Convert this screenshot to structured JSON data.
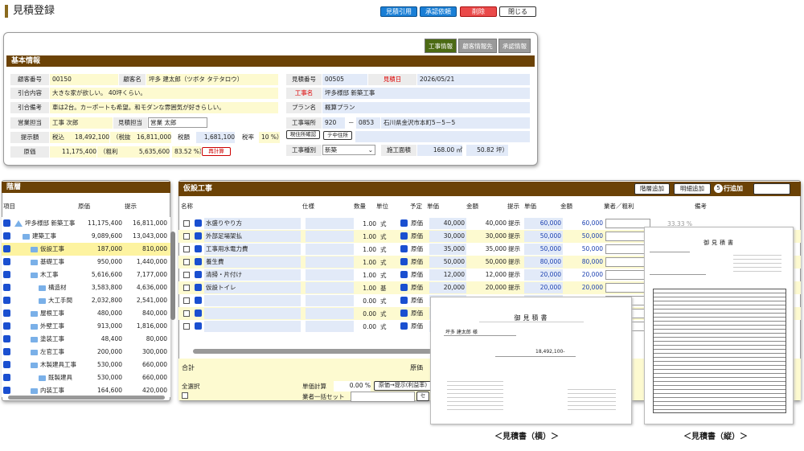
{
  "page": {
    "title": "見積登録"
  },
  "top_buttons": [
    {
      "label": "見積引用",
      "style": "blue"
    },
    {
      "label": "承認依頼",
      "style": "blue"
    },
    {
      "label": "削除",
      "style": "red"
    },
    {
      "label": "閉じる",
      "style": "white"
    }
  ],
  "info_tabs": [
    "工事情報",
    "顧客情報先",
    "承認情報"
  ],
  "basic": {
    "header": "基本情報",
    "customer_no_label": "顧客番号",
    "customer_no": "00150",
    "customer_name_label": "顧客名",
    "customer_name": "坪多 建太郎（ツボタ タテタロウ）",
    "estimate_no_label": "見積番号",
    "estimate_no": "00505",
    "estimate_date_label": "見積日",
    "estimate_date": "2026/05/21",
    "req_label": "引合内容",
    "req": "大きな家が欲しい。 40坪くらい。",
    "work_name_label": "工事名",
    "work_name": "坪多様邸 新築工事",
    "memo_label": "引合備考",
    "memo": "車は2台。カーポートも希望。和モダンな雰囲気が好きらしい。",
    "plan_label": "プラン名",
    "plan": "概算プラン",
    "sales_label": "営業担当",
    "sales": "工事 次郎",
    "est_staff_label": "見積担当",
    "est_staff": "営業 太郎",
    "site_label": "工事場所",
    "zip1": "920",
    "zip_sep": "－",
    "zip2": "0853",
    "address": "石川県金沢市本町5－5－5",
    "btn_site": "現住所確認",
    "btn_addr": "テ中住所",
    "price_label": "提示額",
    "tax_in_label": "税込",
    "tax_in": "18,492,100",
    "tax_ex_label": "（税抜",
    "tax_ex": "16,811,000",
    "tax_label": "税額",
    "tax": "1,681,100",
    "rate_label": "税率",
    "rate": "10 %）",
    "kind_label": "工事種別",
    "kind": "新築",
    "cost_label": "原価",
    "cost": "11,175,400",
    "profit_label": "（粗利",
    "profit": "5,635,600",
    "profit_rate": "83.52 %）",
    "btn_recalc": "再計算",
    "area_label": "施工面積",
    "area": "168.00 ㎡",
    "tsubo": "50.82 坪）"
  },
  "tree": {
    "header": "階層",
    "col_item": "項目",
    "col_cost": "原価",
    "col_price": "提示",
    "rows": [
      {
        "name": "坪多様邸 新築工事",
        "cost": "11,175,400",
        "price": "16,811,000",
        "level": 0,
        "sel": false
      },
      {
        "name": "建築工事",
        "cost": "9,089,600",
        "price": "13,043,000",
        "level": 1,
        "sel": false
      },
      {
        "name": "仮設工事",
        "cost": "187,000",
        "price": "810,000",
        "level": 2,
        "sel": true
      },
      {
        "name": "基礎工事",
        "cost": "950,000",
        "price": "1,440,000",
        "level": 2,
        "sel": false
      },
      {
        "name": "木工事",
        "cost": "5,616,600",
        "price": "7,177,000",
        "level": 2,
        "sel": false
      },
      {
        "name": "構造材",
        "cost": "3,583,800",
        "price": "4,636,000",
        "level": 3,
        "sel": false
      },
      {
        "name": "大工手間",
        "cost": "2,032,800",
        "price": "2,541,000",
        "level": 3,
        "sel": false
      },
      {
        "name": "屋根工事",
        "cost": "480,000",
        "price": "840,000",
        "level": 2,
        "sel": false
      },
      {
        "name": "外壁工事",
        "cost": "913,000",
        "price": "1,816,000",
        "level": 2,
        "sel": false
      },
      {
        "name": "塗装工事",
        "cost": "48,400",
        "price": "80,000",
        "level": 2,
        "sel": false
      },
      {
        "name": "左官工事",
        "cost": "200,000",
        "price": "300,000",
        "level": 2,
        "sel": false
      },
      {
        "name": "木製建具工事",
        "cost": "530,000",
        "price": "660,000",
        "level": 2,
        "sel": false
      },
      {
        "name": "既製建具",
        "cost": "530,000",
        "price": "660,000",
        "level": 3,
        "sel": false
      },
      {
        "name": "内装工事",
        "cost": "164,600",
        "price": "420,000",
        "level": 2,
        "sel": false
      }
    ]
  },
  "detail": {
    "header": "仮設工事",
    "btn_add_layer": "階層追加",
    "btn_add_detail": "明細追加",
    "add_count": "5",
    "add_rows_label": "行追加",
    "btn_all": "全行",
    "cols": {
      "name": "名称",
      "spec": "仕様",
      "qty": "数量",
      "unit": "単位",
      "plan": "予定",
      "unit_price": "単価",
      "amount": "金額",
      "present": "提示",
      "p_unit": "単価",
      "p_amount": "金額",
      "vendor": "業者／粗利",
      "note": "備考"
    },
    "rows": [
      {
        "name": "水盛りやり方",
        "qty": "1.00",
        "unit": "式",
        "plan": "原価",
        "up": "40,000",
        "amt": "40,000",
        "pr": "提示",
        "pu": "60,000",
        "pa": "60,000"
      },
      {
        "name": "外部足場架払",
        "qty": "1.00",
        "unit": "式",
        "plan": "原価",
        "up": "30,000",
        "amt": "30,000",
        "pr": "提示",
        "pu": "50,000",
        "pa": "50,000"
      },
      {
        "name": "工事用水電力費",
        "qty": "1.00",
        "unit": "式",
        "plan": "原価",
        "up": "35,000",
        "amt": "35,000",
        "pr": "提示",
        "pu": "50,000",
        "pa": "50,000"
      },
      {
        "name": "養生費",
        "qty": "1.00",
        "unit": "式",
        "plan": "原価",
        "up": "50,000",
        "amt": "50,000",
        "pr": "提示",
        "pu": "80,000",
        "pa": "80,000"
      },
      {
        "name": "清掃・片付け",
        "qty": "1.00",
        "unit": "式",
        "plan": "原価",
        "up": "12,000",
        "amt": "12,000",
        "pr": "提示",
        "pu": "20,000",
        "pa": "20,000"
      },
      {
        "name": "仮設トイレ",
        "qty": "1.00",
        "unit": "基",
        "plan": "原価",
        "up": "20,000",
        "amt": "20,000",
        "pr": "提示",
        "pu": "20,000",
        "pa": "20,000"
      },
      {
        "name": "",
        "qty": "0.00",
        "unit": "式",
        "plan": "原価",
        "up": "",
        "amt": "",
        "pr": "",
        "pu": "",
        "pa": ""
      },
      {
        "name": "",
        "qty": "0.00",
        "unit": "式",
        "plan": "原価",
        "up": "",
        "amt": "",
        "pr": "",
        "pu": "",
        "pa": ""
      },
      {
        "name": "",
        "qty": "0.00",
        "unit": "式",
        "plan": "原価",
        "up": "",
        "amt": "",
        "pr": "",
        "pu": "",
        "pa": ""
      }
    ],
    "first_rate": "33.33 %",
    "total_label": "合計",
    "total_cost_label": "原価",
    "all_select": "全選択",
    "unit_calc_label": "単価計算",
    "unit_calc_val": "0.00 %",
    "btn_calc": "原価→提示(利益率)",
    "vendor_set_label": "業者一括セット"
  },
  "previews": {
    "landscape_label": "＜見積書（横）＞",
    "portrait_label": "＜見積書（縦）＞",
    "doc_title": "御見積書",
    "customer": "坪多 建太郎 様",
    "amount": "18,492,100-"
  }
}
